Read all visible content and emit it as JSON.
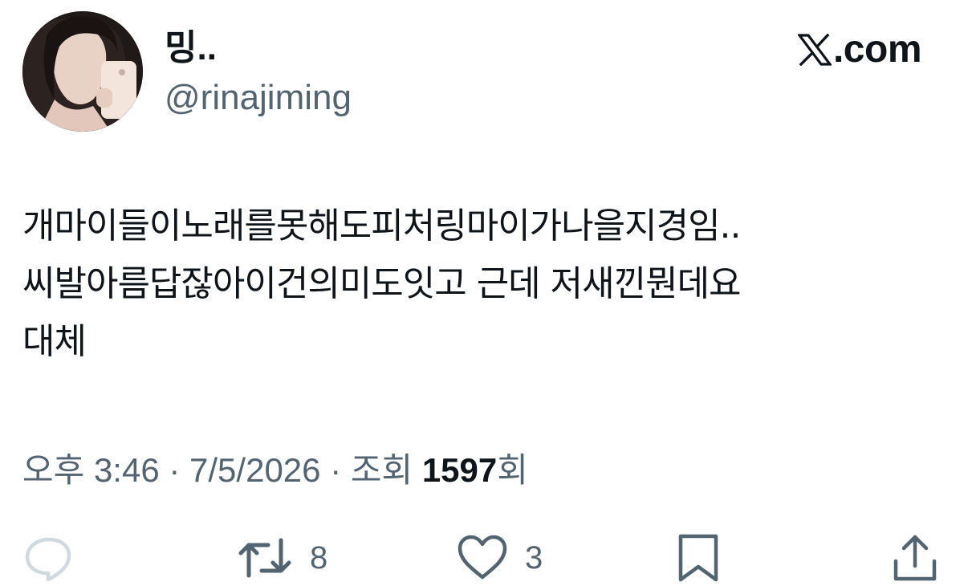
{
  "author": {
    "display_name": "밍..",
    "handle": "@rinajiming"
  },
  "brand": {
    "name": ".com",
    "logo_icon": "x-logo-icon"
  },
  "tweet": {
    "text": "개마이들이노래를못해도피처링마이가나을지경임..\n씨발아름답잖아이건의미도잇고 근데 저새낀뭔데요\n대체"
  },
  "meta": {
    "time": "오후 3:46",
    "sep1": " · ",
    "date": "7/5/2026",
    "sep2": " · ",
    "views_prefix": "조회 ",
    "views_count": "1597",
    "views_suffix": "회"
  },
  "actions": {
    "reply_icon": "reply-icon",
    "retweet_icon": "retweet-icon",
    "retweet_count": "8",
    "like_icon": "heart-icon",
    "like_count": "3",
    "bookmark_icon": "bookmark-icon",
    "share_icon": "share-icon"
  },
  "colors": {
    "text_primary": "#0f1419",
    "text_secondary": "#536471",
    "reply_icon_faded": "#cfd9de"
  }
}
